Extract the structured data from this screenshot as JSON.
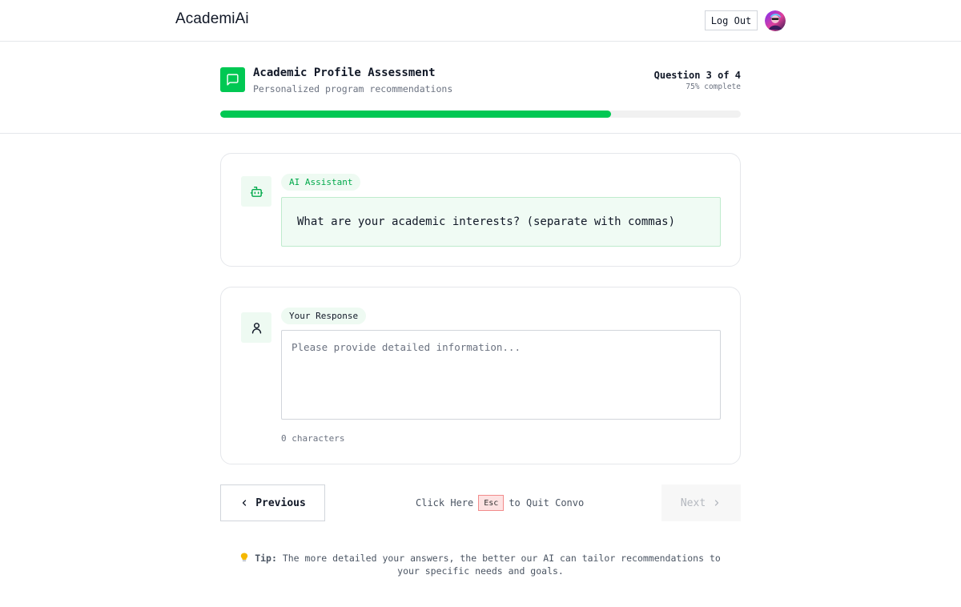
{
  "nav": {
    "brand": "AcademiAi",
    "logout_label": "Log Out"
  },
  "header": {
    "title": "Academic Profile Assessment",
    "subtitle": "Personalized program recommendations",
    "question_counter": "Question 3 of 4",
    "percent_complete": "75% complete",
    "progress": 0.75
  },
  "ai_card": {
    "role_label": "AI Assistant",
    "question": "What are your academic interests? (separate with commas)"
  },
  "user_card": {
    "role_label": "Your Response",
    "response_value": "",
    "response_placeholder": "Please provide detailed information...",
    "char_count": "0 characters"
  },
  "footer_nav": {
    "previous_label": "Previous",
    "next_label": "Next",
    "quit_prefix": "Click Here",
    "esc_key": "Esc",
    "quit_suffix": "to Quit Convo"
  },
  "tip": {
    "label": "Tip:",
    "text": "The more detailed your answers, the better our AI can tailor recommendations to your specific needs and goals."
  },
  "colors": {
    "accent": "#00c853",
    "accent_text": "#00a94a",
    "accent_soft": "#eefaf2",
    "esc_bg": "#fde2e2",
    "esc_border": "#f28b8b"
  },
  "icons": {
    "header": "message-square-icon",
    "ai": "bot-icon",
    "user": "user-icon",
    "previous": "chevron-left-icon",
    "next": "chevron-right-icon",
    "tip": "lightbulb-icon"
  }
}
